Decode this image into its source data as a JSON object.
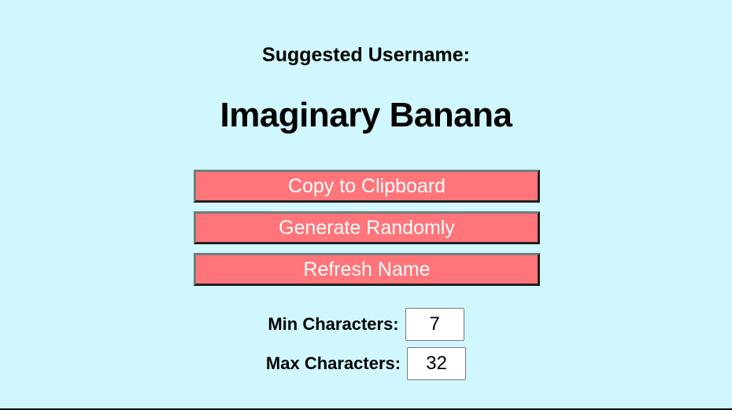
{
  "header": {
    "label": "Suggested Username:",
    "username": "Imaginary Banana"
  },
  "actions": {
    "copy_label": "Copy to Clipboard",
    "generate_label": "Generate Randomly",
    "refresh_label": "Refresh Name"
  },
  "settings": {
    "min_label": "Min Characters:",
    "min_value": "7",
    "max_label": "Max Characters:",
    "max_value": "32"
  },
  "colors": {
    "background": "#d0f7fd",
    "button": "#ff757a",
    "button_text": "#ffffff"
  }
}
